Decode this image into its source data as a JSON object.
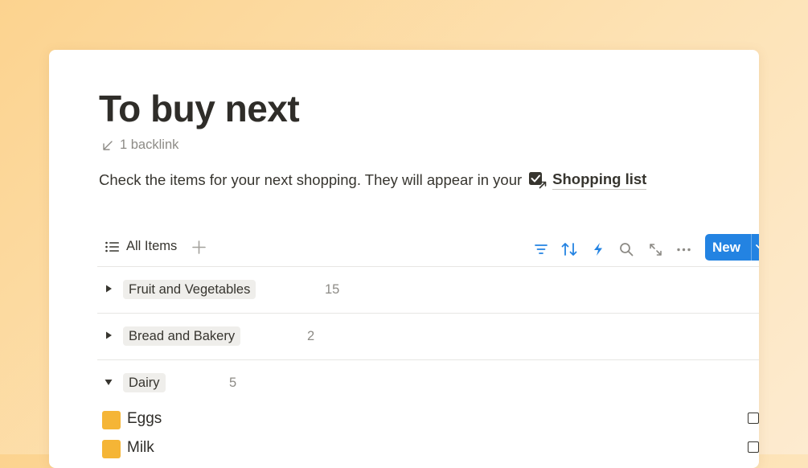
{
  "page": {
    "title": "To buy next",
    "backlink_text": "1 backlink",
    "description": "Check the items for your next shopping. They will appear in your",
    "linked_page": "Shopping list"
  },
  "toolbar": {
    "view_label": "All Items",
    "new_label": "New",
    "icons": [
      "list-icon",
      "plus-icon",
      "filter-icon",
      "sort-icon",
      "lightning-icon",
      "search-icon",
      "expand-icon",
      "more-icon",
      "chevron-down-icon"
    ]
  },
  "groups": [
    {
      "name": "Fruit and Vegetables",
      "count": "15",
      "expanded": false
    },
    {
      "name": "Bread and Bakery",
      "count": "2",
      "expanded": false
    },
    {
      "name": "Dairy",
      "count": "5",
      "expanded": true
    }
  ],
  "items": [
    {
      "label": "Eggs"
    },
    {
      "label": "Milk"
    }
  ],
  "colors": {
    "accent": "#2383e2",
    "item_icon": "#f5b536",
    "tag_bg": "#efeeeb",
    "text": "#37352f",
    "muted": "#8d8b86"
  }
}
